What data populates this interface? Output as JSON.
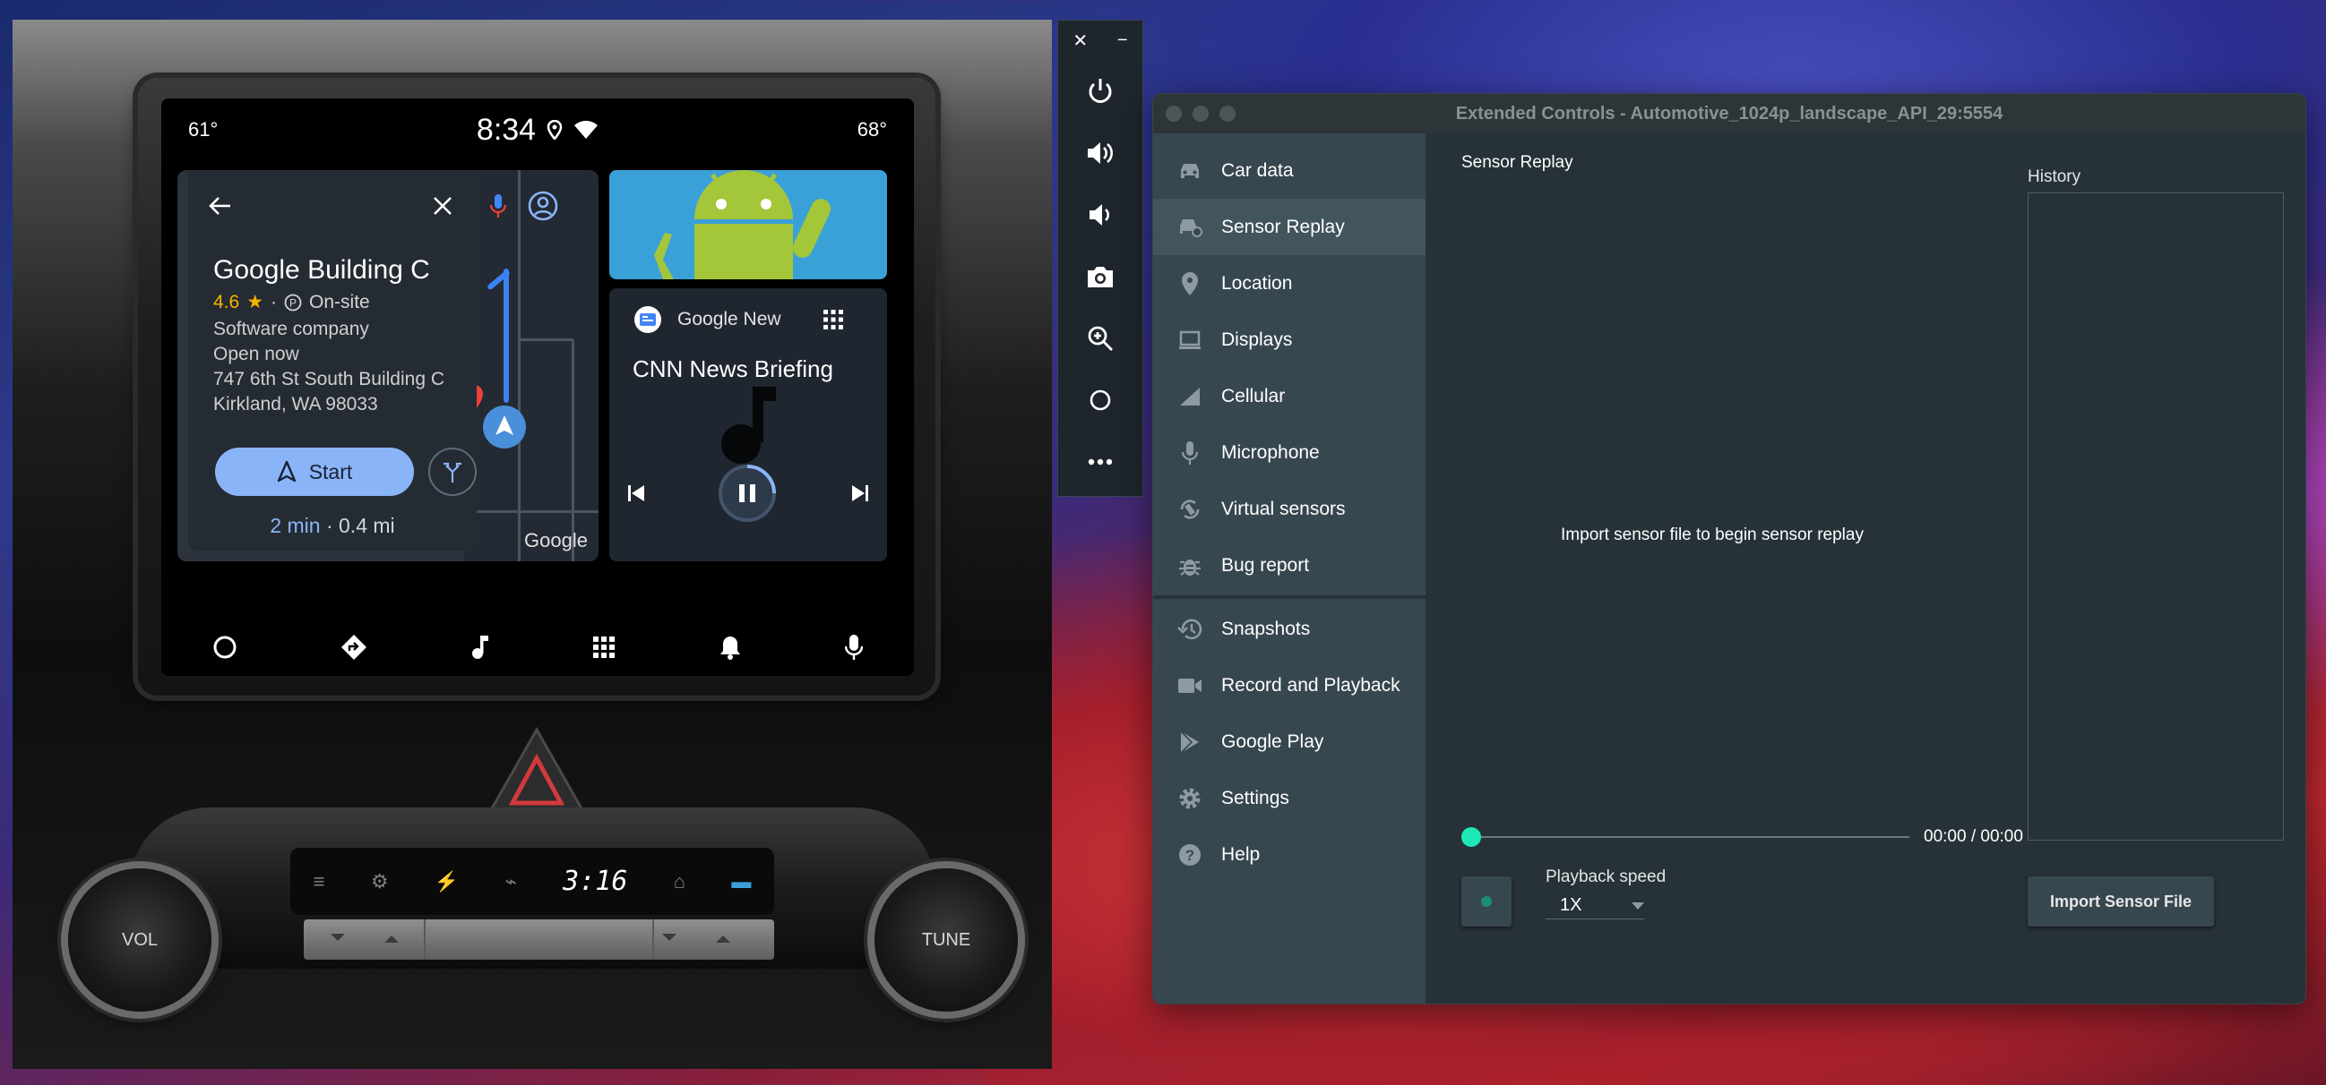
{
  "emulator": {
    "status": {
      "temp_left": "61°",
      "time": "8:34",
      "temp_right": "68°"
    },
    "maps": {
      "place_name": "Google Building C",
      "rating": "4.6",
      "star": "★",
      "parking": "On-site",
      "category": "Software company",
      "hours": "Open now",
      "address_line1": "747 6th St South Building C",
      "address_line2": "Kirkland, WA 98033",
      "start_label": "Start",
      "eta_time": "2 min",
      "eta_distance": " · 0.4 mi",
      "google_mark": "Google"
    },
    "media": {
      "app_name": "Google New",
      "title": "CNN News Briefing"
    },
    "climate": {
      "display_time": "3:16"
    },
    "knobs": {
      "left": "VOL",
      "right": "TUNE"
    }
  },
  "toolbar": {
    "close": "✕",
    "minimize": "−"
  },
  "window": {
    "title": "Extended Controls - Automotive_1024p_landscape_API_29:5554",
    "nav": [
      {
        "label": "Car data",
        "icon": "car-icon"
      },
      {
        "label": "Sensor Replay",
        "icon": "sensor-replay-icon"
      },
      {
        "label": "Location",
        "icon": "location-pin-icon"
      },
      {
        "label": "Displays",
        "icon": "display-icon"
      },
      {
        "label": "Cellular",
        "icon": "signal-icon"
      },
      {
        "label": "Microphone",
        "icon": "microphone-icon"
      },
      {
        "label": "Virtual sensors",
        "icon": "rotate-icon"
      },
      {
        "label": "Bug report",
        "icon": "bug-icon"
      },
      {
        "label": "Snapshots",
        "icon": "history-icon"
      },
      {
        "label": "Record and Playback",
        "icon": "video-camera-icon"
      },
      {
        "label": "Google Play",
        "icon": "play-store-icon"
      },
      {
        "label": "Settings",
        "icon": "gear-icon"
      },
      {
        "label": "Help",
        "icon": "help-icon"
      }
    ],
    "active_nav": "Sensor Replay",
    "content": {
      "section_title": "Sensor Replay",
      "history_label": "History",
      "hint": "Import sensor file to begin sensor replay",
      "time_readout": "00:00 / 00:00",
      "speed_label": "Playback speed",
      "speed_value": "1X",
      "import_label": "Import Sensor File"
    },
    "colors": {
      "accent": "#1de9b6",
      "sidebar": "#37474f",
      "background": "#263238"
    }
  }
}
